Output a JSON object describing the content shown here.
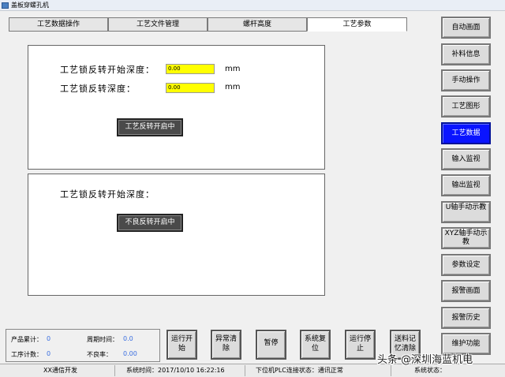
{
  "window": {
    "title": "盖板穿螺孔机"
  },
  "tabs": [
    {
      "label": "工艺数据操作",
      "active": false
    },
    {
      "label": "工艺文件管理",
      "active": false
    },
    {
      "label": "螺杆高度",
      "active": false
    },
    {
      "label": "工艺参数",
      "active": true
    }
  ],
  "panel1": {
    "start_depth_label": "工艺锁反转开始深度：",
    "start_depth_value": "0.00",
    "depth_label": "工艺锁反转深度：",
    "depth_value": "0.00",
    "unit": "mm",
    "button": "工艺反转开启中"
  },
  "panel2": {
    "start_depth_label": "工艺锁反转开始深度：",
    "button": "不良反转开启中"
  },
  "sidebar": {
    "items": [
      {
        "label": "自动画面"
      },
      {
        "label": "补料信息"
      },
      {
        "label": "手动操作"
      },
      {
        "label": "工艺图形"
      },
      {
        "label": "工艺数据",
        "active": true
      },
      {
        "label": "输入监视"
      },
      {
        "label": "输出监视"
      },
      {
        "label": "U轴手动示教"
      },
      {
        "label": "XYZ轴手动示教"
      },
      {
        "label": "参数设定"
      },
      {
        "label": "报警画面"
      },
      {
        "label": "报警历史"
      },
      {
        "label": "维护功能"
      }
    ]
  },
  "counters": {
    "product_total_label": "产品累计：",
    "product_total_value": "0",
    "cycle_time_label": "周期时间：",
    "cycle_time_value": "0.0",
    "step_count_label": "工序计数：",
    "step_count_value": "0",
    "defect_rate_label": "不良率：",
    "defect_rate_value": "0.00"
  },
  "bottom_buttons": [
    {
      "label": "运行开始"
    },
    {
      "label": "异常清除"
    },
    {
      "label": "暂停"
    },
    {
      "label": "系统复位"
    },
    {
      "label": "运行停止"
    },
    {
      "label": "送料记忆清除"
    }
  ],
  "status": {
    "comm": "XX通信开发",
    "system_time": "系统时间：2017/10/10 16:22:16",
    "plc_state": "下位机PLC连接状态：通讯正常",
    "system_state": "系统状态："
  },
  "watermark": "头条 @深圳海蓝机电",
  "colors": {
    "active_blue": "#0a14ff",
    "value_yellow": "#ffff00",
    "counter_value": "#3a6ee0"
  }
}
